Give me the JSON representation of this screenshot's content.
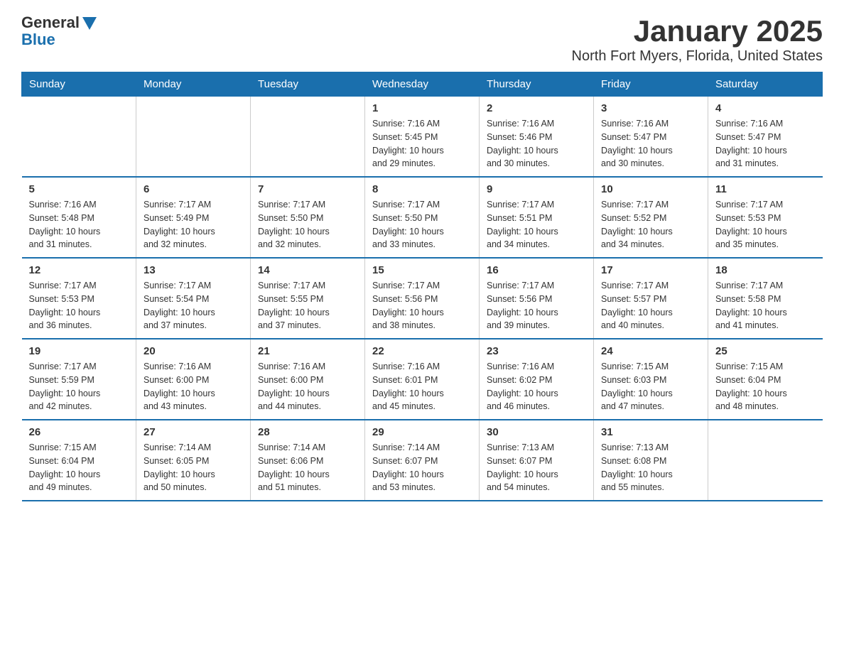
{
  "logo": {
    "general": "General",
    "blue": "Blue"
  },
  "title": "January 2025",
  "subtitle": "North Fort Myers, Florida, United States",
  "weekdays": [
    "Sunday",
    "Monday",
    "Tuesday",
    "Wednesday",
    "Thursday",
    "Friday",
    "Saturday"
  ],
  "weeks": [
    [
      {
        "day": "",
        "info": ""
      },
      {
        "day": "",
        "info": ""
      },
      {
        "day": "",
        "info": ""
      },
      {
        "day": "1",
        "info": "Sunrise: 7:16 AM\nSunset: 5:45 PM\nDaylight: 10 hours\nand 29 minutes."
      },
      {
        "day": "2",
        "info": "Sunrise: 7:16 AM\nSunset: 5:46 PM\nDaylight: 10 hours\nand 30 minutes."
      },
      {
        "day": "3",
        "info": "Sunrise: 7:16 AM\nSunset: 5:47 PM\nDaylight: 10 hours\nand 30 minutes."
      },
      {
        "day": "4",
        "info": "Sunrise: 7:16 AM\nSunset: 5:47 PM\nDaylight: 10 hours\nand 31 minutes."
      }
    ],
    [
      {
        "day": "5",
        "info": "Sunrise: 7:16 AM\nSunset: 5:48 PM\nDaylight: 10 hours\nand 31 minutes."
      },
      {
        "day": "6",
        "info": "Sunrise: 7:17 AM\nSunset: 5:49 PM\nDaylight: 10 hours\nand 32 minutes."
      },
      {
        "day": "7",
        "info": "Sunrise: 7:17 AM\nSunset: 5:50 PM\nDaylight: 10 hours\nand 32 minutes."
      },
      {
        "day": "8",
        "info": "Sunrise: 7:17 AM\nSunset: 5:50 PM\nDaylight: 10 hours\nand 33 minutes."
      },
      {
        "day": "9",
        "info": "Sunrise: 7:17 AM\nSunset: 5:51 PM\nDaylight: 10 hours\nand 34 minutes."
      },
      {
        "day": "10",
        "info": "Sunrise: 7:17 AM\nSunset: 5:52 PM\nDaylight: 10 hours\nand 34 minutes."
      },
      {
        "day": "11",
        "info": "Sunrise: 7:17 AM\nSunset: 5:53 PM\nDaylight: 10 hours\nand 35 minutes."
      }
    ],
    [
      {
        "day": "12",
        "info": "Sunrise: 7:17 AM\nSunset: 5:53 PM\nDaylight: 10 hours\nand 36 minutes."
      },
      {
        "day": "13",
        "info": "Sunrise: 7:17 AM\nSunset: 5:54 PM\nDaylight: 10 hours\nand 37 minutes."
      },
      {
        "day": "14",
        "info": "Sunrise: 7:17 AM\nSunset: 5:55 PM\nDaylight: 10 hours\nand 37 minutes."
      },
      {
        "day": "15",
        "info": "Sunrise: 7:17 AM\nSunset: 5:56 PM\nDaylight: 10 hours\nand 38 minutes."
      },
      {
        "day": "16",
        "info": "Sunrise: 7:17 AM\nSunset: 5:56 PM\nDaylight: 10 hours\nand 39 minutes."
      },
      {
        "day": "17",
        "info": "Sunrise: 7:17 AM\nSunset: 5:57 PM\nDaylight: 10 hours\nand 40 minutes."
      },
      {
        "day": "18",
        "info": "Sunrise: 7:17 AM\nSunset: 5:58 PM\nDaylight: 10 hours\nand 41 minutes."
      }
    ],
    [
      {
        "day": "19",
        "info": "Sunrise: 7:17 AM\nSunset: 5:59 PM\nDaylight: 10 hours\nand 42 minutes."
      },
      {
        "day": "20",
        "info": "Sunrise: 7:16 AM\nSunset: 6:00 PM\nDaylight: 10 hours\nand 43 minutes."
      },
      {
        "day": "21",
        "info": "Sunrise: 7:16 AM\nSunset: 6:00 PM\nDaylight: 10 hours\nand 44 minutes."
      },
      {
        "day": "22",
        "info": "Sunrise: 7:16 AM\nSunset: 6:01 PM\nDaylight: 10 hours\nand 45 minutes."
      },
      {
        "day": "23",
        "info": "Sunrise: 7:16 AM\nSunset: 6:02 PM\nDaylight: 10 hours\nand 46 minutes."
      },
      {
        "day": "24",
        "info": "Sunrise: 7:15 AM\nSunset: 6:03 PM\nDaylight: 10 hours\nand 47 minutes."
      },
      {
        "day": "25",
        "info": "Sunrise: 7:15 AM\nSunset: 6:04 PM\nDaylight: 10 hours\nand 48 minutes."
      }
    ],
    [
      {
        "day": "26",
        "info": "Sunrise: 7:15 AM\nSunset: 6:04 PM\nDaylight: 10 hours\nand 49 minutes."
      },
      {
        "day": "27",
        "info": "Sunrise: 7:14 AM\nSunset: 6:05 PM\nDaylight: 10 hours\nand 50 minutes."
      },
      {
        "day": "28",
        "info": "Sunrise: 7:14 AM\nSunset: 6:06 PM\nDaylight: 10 hours\nand 51 minutes."
      },
      {
        "day": "29",
        "info": "Sunrise: 7:14 AM\nSunset: 6:07 PM\nDaylight: 10 hours\nand 53 minutes."
      },
      {
        "day": "30",
        "info": "Sunrise: 7:13 AM\nSunset: 6:07 PM\nDaylight: 10 hours\nand 54 minutes."
      },
      {
        "day": "31",
        "info": "Sunrise: 7:13 AM\nSunset: 6:08 PM\nDaylight: 10 hours\nand 55 minutes."
      },
      {
        "day": "",
        "info": ""
      }
    ]
  ]
}
